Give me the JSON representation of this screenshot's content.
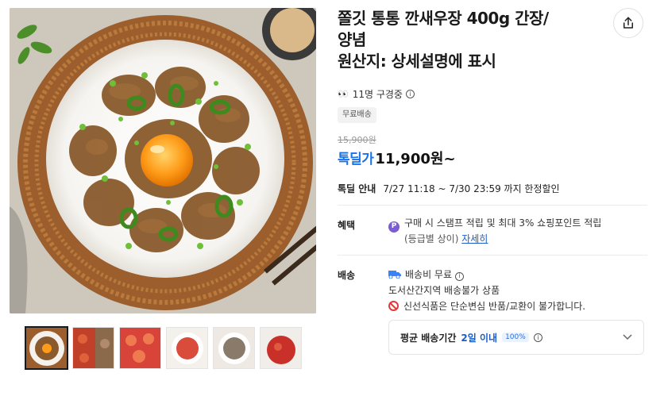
{
  "product": {
    "title_line1": "쫄깃 통통 깐새우장 400g 간장/",
    "title_line2": "양념",
    "title_line3": "원산지: 상세설명에 표시"
  },
  "viewers": {
    "eyes": "👀",
    "text": "11명 구경중",
    "info_icon": "i"
  },
  "badge": "무료배송",
  "price": {
    "original": "15,900원",
    "deal_label": "톡딜가",
    "current": "11,900원~"
  },
  "deal_info": {
    "label": "톡딜 안내",
    "value": "7/27 11:18 ~ 7/30 23:59 까지 한정할인"
  },
  "benefit": {
    "label": "혜택",
    "icon": "P",
    "line1": "구매 시 스탬프 적립 및 최대 3% 쇼핑포인트 적립",
    "line2": "(등급별 상이)",
    "link": "자세히"
  },
  "shipping": {
    "label": "배송",
    "fee": "배송비 무료",
    "region": "도서산간지역 배송불가 상품",
    "notice": "신선식품은 단순변심 반품/교환이 불가합니다."
  },
  "delivery": {
    "label": "평균 배송기간",
    "value": "2일 이내",
    "chip": "100%"
  },
  "icons": {
    "share": "share-icon",
    "chevron": "chevron-down-icon"
  },
  "colors": {
    "accent": "#1a73e8",
    "link": "#1a5dc9",
    "warn": "#e03b3b"
  }
}
